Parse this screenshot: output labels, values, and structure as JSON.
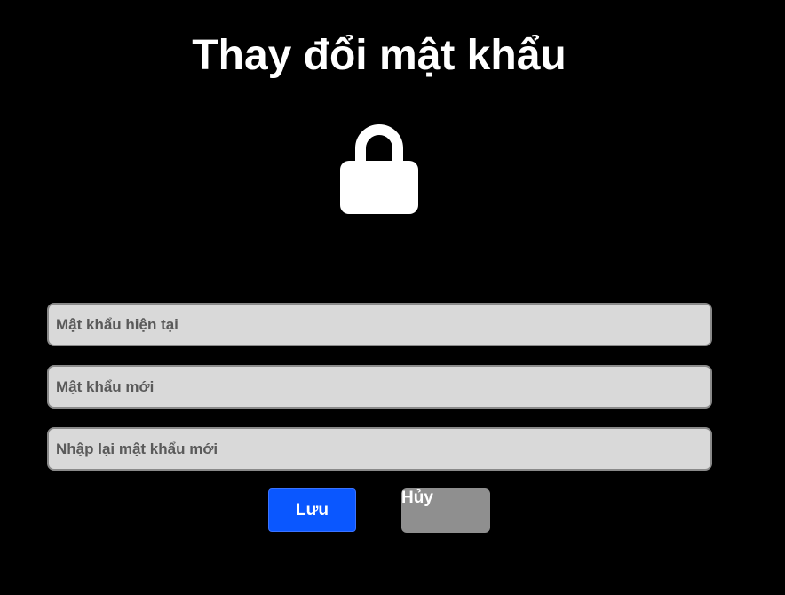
{
  "page": {
    "title": "Thay đổi mật khẩu"
  },
  "icon": {
    "name": "lock-icon",
    "color": "#ffffff"
  },
  "form": {
    "current_password": {
      "placeholder": "Mật khẩu hiện tại",
      "value": ""
    },
    "new_password": {
      "placeholder": "Mật khẩu mới",
      "value": ""
    },
    "confirm_password": {
      "placeholder": "Nhập lại mật khẩu mới",
      "value": ""
    }
  },
  "actions": {
    "save_label": "Lưu",
    "cancel_label": "Hủy"
  },
  "colors": {
    "background": "#000000",
    "save_button": "#0a57ff",
    "cancel_button": "#8f8f8f",
    "field_background": "#d9d9d9"
  }
}
